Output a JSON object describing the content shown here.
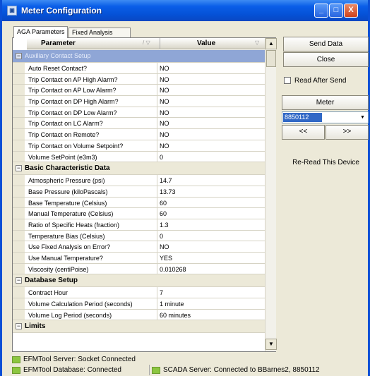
{
  "window": {
    "title": "Meter Configuration",
    "minimize": "_",
    "maximize": "□",
    "close": "X"
  },
  "tabs": [
    {
      "label": "AGA Parameters",
      "active": true
    },
    {
      "label": "Fixed Analysis",
      "active": false
    }
  ],
  "grid": {
    "headers": {
      "parameter": "Parameter",
      "value": "Value",
      "sort_glyph": "/ ▽",
      "sort_glyph2": "▽"
    },
    "expand_collapsed": "−",
    "sections": [
      {
        "title": "Auxiliary Contact Setup",
        "selected": true,
        "rows": [
          {
            "name": "Auto Reset Contact?",
            "value": "NO"
          },
          {
            "name": "Trip Contact on AP High Alarm?",
            "value": "NO"
          },
          {
            "name": "Trip Contact on AP Low Alarm?",
            "value": "NO"
          },
          {
            "name": "Trip Contact on DP High Alarm?",
            "value": "NO"
          },
          {
            "name": "Trip Contact on DP Low Alarm?",
            "value": "NO"
          },
          {
            "name": "Trip Contact on LC Alarm?",
            "value": "NO"
          },
          {
            "name": "Trip Contact on Remote?",
            "value": "NO"
          },
          {
            "name": "Trip Contact on Volume Setpoint?",
            "value": "NO"
          },
          {
            "name": "Volume SetPoint (e3m3)",
            "value": "0"
          }
        ]
      },
      {
        "title": "Basic Characteristic Data",
        "selected": false,
        "rows": [
          {
            "name": "Atmospheric Pressure (psi)",
            "value": "14.7"
          },
          {
            "name": "Base Pressure (kiloPascals)",
            "value": "13.73"
          },
          {
            "name": "Base Temperature (Celsius)",
            "value": "60"
          },
          {
            "name": "Manual Temperature (Celsius)",
            "value": "60"
          },
          {
            "name": "Ratio of Specific Heats (fraction)",
            "value": "1.3"
          },
          {
            "name": "Temperature Bias (Celsius)",
            "value": "0"
          },
          {
            "name": "Use Fixed Analysis on Error?",
            "value": "NO"
          },
          {
            "name": "Use Manual Temperature?",
            "value": "YES"
          },
          {
            "name": "Viscosity (centiPoise)",
            "value": "0.010268"
          }
        ]
      },
      {
        "title": "Database Setup",
        "selected": false,
        "rows": [
          {
            "name": "Contract Hour",
            "value": "7"
          },
          {
            "name": "Volume Calculation Period (seconds)",
            "value": "1 minute"
          },
          {
            "name": "Volume Log Period (seconds)",
            "value": "60 minutes"
          }
        ]
      },
      {
        "title": "Limits",
        "selected": false,
        "rows": []
      }
    ],
    "scroll_up": "▲",
    "scroll_down": "▼"
  },
  "side_panel": {
    "send_data": "Send Data",
    "close": "Close",
    "read_after_send": "Read After Send",
    "read_after_send_checked": false,
    "meter_title": "Meter",
    "meter_selected": "8850112",
    "meter_arrow": "▼",
    "prev": "<<",
    "next": ">>",
    "reread": "Re-Read This Device"
  },
  "status": {
    "server": "EFMTool Server: Socket Connected",
    "database": "EFMTool Database: Connected",
    "scada": "SCADA Server: Connected to BBarnes2, 8850112",
    "led_color": "#8cc63f"
  }
}
